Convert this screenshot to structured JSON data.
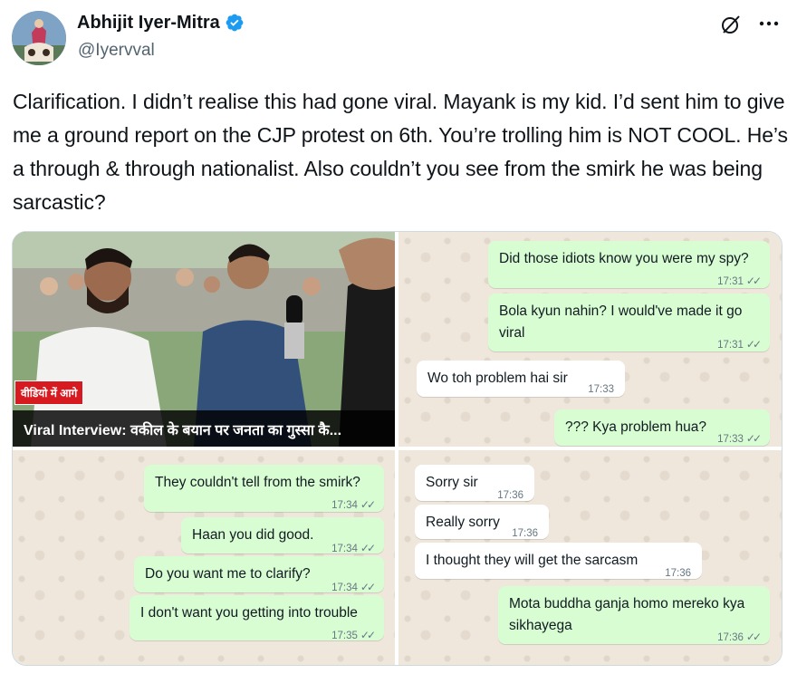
{
  "author": {
    "name": "Abhijit Iyer-Mitra",
    "handle": "@Iyervval",
    "verified_color": "#1d9bf0"
  },
  "icons": [
    "verified-badge-icon",
    "grok-icon",
    "more-icon"
  ],
  "tweet": {
    "text": "Clarification. I didn’t realise this had gone viral. Mayank is my kid. I’d sent him to give me a ground report on the CJP protest on 6th. You’re trolling him is NOT COOL. He’s a through & through nationalist. Also couldn’t you see from the smirk he was being sarcastic?"
  },
  "media": {
    "video": {
      "tag": "वीडियो में आगे",
      "caption": "Viral Interview: वकील के बयान पर जनता का गुस्सा कै..."
    },
    "chat1": [
      {
        "dir": "out",
        "text": "Did those idiots know you were my spy?",
        "time": "17:31"
      },
      {
        "dir": "out",
        "text": "Bola kyun nahin? I would've made it go",
        "text2": "viral",
        "time": "17:31"
      },
      {
        "dir": "in",
        "text": "Wo toh problem hai sir",
        "time": "17:33"
      },
      {
        "dir": "out",
        "text": "??? Kya problem hua?",
        "time": "17:33"
      }
    ],
    "chat2": [
      {
        "dir": "out",
        "text": "They couldn't tell from the smirk?",
        "time": "17:34"
      },
      {
        "dir": "out",
        "text": "Haan you did good.",
        "time": "17:34"
      },
      {
        "dir": "out",
        "text": "Do you want me to clarify?",
        "time": "17:34"
      },
      {
        "dir": "out",
        "text": "I don't want you getting into trouble",
        "time": "17:35"
      }
    ],
    "chat3": [
      {
        "dir": "in",
        "text": "Sorry sir",
        "time": "17:36"
      },
      {
        "dir": "in",
        "text": "Really sorry",
        "time": "17:36"
      },
      {
        "dir": "in",
        "text": "I thought they will get the sarcasm",
        "time": "17:36"
      },
      {
        "dir": "out",
        "text": "Mota buddha ganja homo mereko kya",
        "text2": "sikhayega",
        "time": "17:36"
      }
    ]
  }
}
